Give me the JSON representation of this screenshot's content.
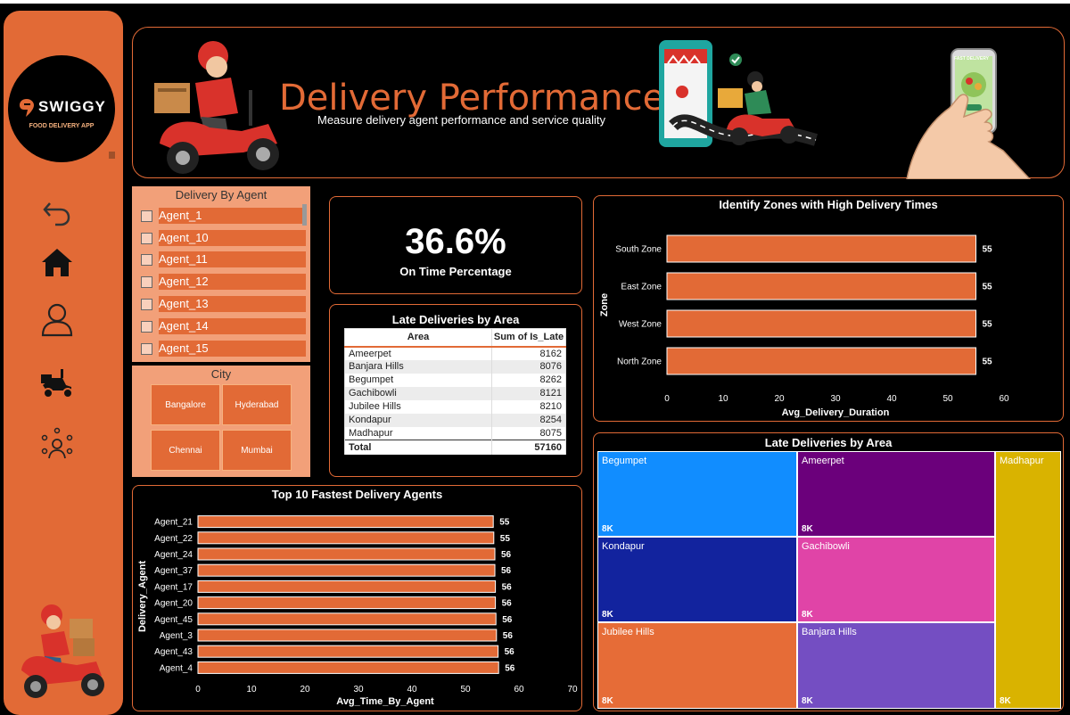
{
  "brand": {
    "name": "SWIGGY",
    "tagline": "FOOD DELIVERY APP"
  },
  "nav": [
    "back-icon",
    "home-icon",
    "user-icon",
    "scooter-icon",
    "network-icon"
  ],
  "header": {
    "title": "Delivery Performance",
    "subtitle": "Measure delivery agent performance and service quality",
    "badge": "FAST DELIVERY"
  },
  "agent_slicer": {
    "title": "Delivery By Agent",
    "items": [
      "Agent_1",
      "Agent_10",
      "Agent_11",
      "Agent_12",
      "Agent_13",
      "Agent_14",
      "Agent_15"
    ]
  },
  "city_slicer": {
    "title": "City",
    "items": [
      "Bangalore",
      "Hyderabad",
      "Chennai",
      "Mumbai"
    ]
  },
  "kpi": {
    "value": "36.6%",
    "label": "On Time Percentage"
  },
  "late_table": {
    "title": "Late Deliveries by Area",
    "headers": [
      "Area",
      "Sum of Is_Late"
    ],
    "rows": [
      [
        "Ameerpet",
        "8162"
      ],
      [
        "Banjara Hills",
        "8076"
      ],
      [
        "Begumpet",
        "8262"
      ],
      [
        "Gachibowli",
        "8121"
      ],
      [
        "Jubilee Hills",
        "8210"
      ],
      [
        "Kondapur",
        "8254"
      ],
      [
        "Madhapur",
        "8075"
      ]
    ],
    "total_label": "Total",
    "total_value": "57160"
  },
  "colors": {
    "accent": "#e26a36",
    "background": "#000000",
    "slicer": "#f2a079"
  },
  "chart_data": [
    {
      "id": "zones",
      "type": "bar",
      "orientation": "horizontal",
      "title": "Identify Zones with High Delivery Times",
      "categories": [
        "South Zone",
        "East Zone",
        "West Zone",
        "North Zone"
      ],
      "values": [
        55,
        55,
        55,
        55
      ],
      "xlabel": "Avg_Delivery_Duration",
      "ylabel": "Zone",
      "xlim": [
        0,
        60
      ],
      "ticks": [
        0,
        10,
        20,
        30,
        40,
        50,
        60
      ],
      "grid": false
    },
    {
      "id": "agents",
      "type": "bar",
      "orientation": "horizontal",
      "title": "Top 10 Fastest Delivery Agents",
      "categories": [
        "Agent_21",
        "Agent_22",
        "Agent_24",
        "Agent_37",
        "Agent_17",
        "Agent_20",
        "Agent_45",
        "Agent_3",
        "Agent_43",
        "Agent_4"
      ],
      "values": [
        55,
        55,
        56,
        56,
        56,
        56,
        56,
        56,
        56,
        56
      ],
      "plot_values": [
        55.2,
        55.3,
        55.5,
        55.5,
        55.6,
        55.6,
        55.7,
        55.8,
        56.1,
        56.2
      ],
      "xlabel": "Avg_Time_By_Agent",
      "ylabel": "Delivery_Agent",
      "xlim": [
        0,
        70
      ],
      "ticks": [
        0,
        10,
        20,
        30,
        40,
        50,
        60,
        70
      ],
      "grid": false
    },
    {
      "id": "treemap",
      "type": "treemap",
      "title": "Late Deliveries by Area",
      "items": [
        {
          "name": "Begumpet",
          "label": "8K",
          "value": 8262,
          "color": "#118dff"
        },
        {
          "name": "Ameerpet",
          "label": "8K",
          "value": 8162,
          "color": "#6b007b"
        },
        {
          "name": "Madhapur",
          "label": "8K",
          "value": 8075,
          "color": "#d9b300"
        },
        {
          "name": "Kondapur",
          "label": "8K",
          "value": 8254,
          "color": "#12239e"
        },
        {
          "name": "Gachibowli",
          "label": "8K",
          "value": 8121,
          "color": "#e044a7"
        },
        {
          "name": "Jubilee Hills",
          "label": "8K",
          "value": 8210,
          "color": "#e66c37"
        },
        {
          "name": "Banjara Hills",
          "label": "8K",
          "value": 8076,
          "color": "#744ec2"
        }
      ]
    }
  ]
}
